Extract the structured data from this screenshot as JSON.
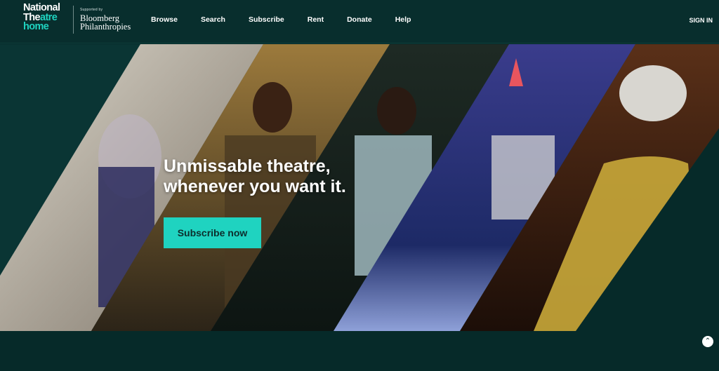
{
  "brand": {
    "line1": "National",
    "line2a": "The",
    "line2b": "atre",
    "line3": "home",
    "sponsor_small": "Supported by",
    "sponsor_name_1": "Bloomberg",
    "sponsor_name_2": "Philanthropies",
    "accent_color": "#1fd3c0",
    "bg_color": "#062a29"
  },
  "nav": {
    "items": [
      "Browse",
      "Search",
      "Subscribe",
      "Rent",
      "Donate",
      "Help"
    ],
    "signin": "SIGN IN"
  },
  "hero": {
    "headline_1": "Unmissable theatre,",
    "headline_2": "whenever you want it.",
    "cta": "Subscribe now"
  },
  "icons": {
    "scroll_top": "chevron-up-icon"
  }
}
